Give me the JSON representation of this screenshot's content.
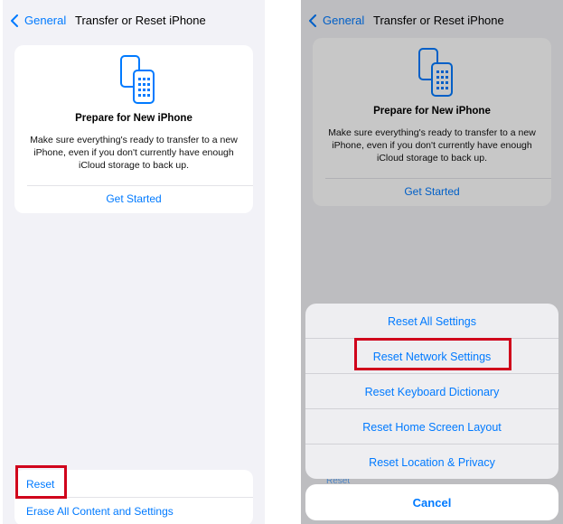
{
  "left": {
    "back_label": "General",
    "title": "Transfer or Reset iPhone",
    "prepare": {
      "title": "Prepare for New iPhone",
      "description": "Make sure everything's ready to transfer to a new iPhone, even if you don't currently have enough iCloud storage to back up.",
      "link": "Get Started"
    },
    "reset_label": "Reset",
    "erase_label": "Erase All Content and Settings"
  },
  "right": {
    "back_label": "General",
    "title": "Transfer or Reset iPhone",
    "prepare": {
      "title": "Prepare for New iPhone",
      "description": "Make sure everything's ready to transfer to a new iPhone, even if you don't currently have enough iCloud storage to back up.",
      "link": "Get Started"
    },
    "peek_label": "Reset",
    "sheet": {
      "items": [
        "Reset All Settings",
        "Reset Network Settings",
        "Reset Keyboard Dictionary",
        "Reset Home Screen Layout",
        "Reset Location & Privacy"
      ],
      "cancel": "Cancel"
    }
  },
  "colors": {
    "accent": "#007aff",
    "highlight": "#d0021b",
    "background": "#f2f2f7"
  }
}
